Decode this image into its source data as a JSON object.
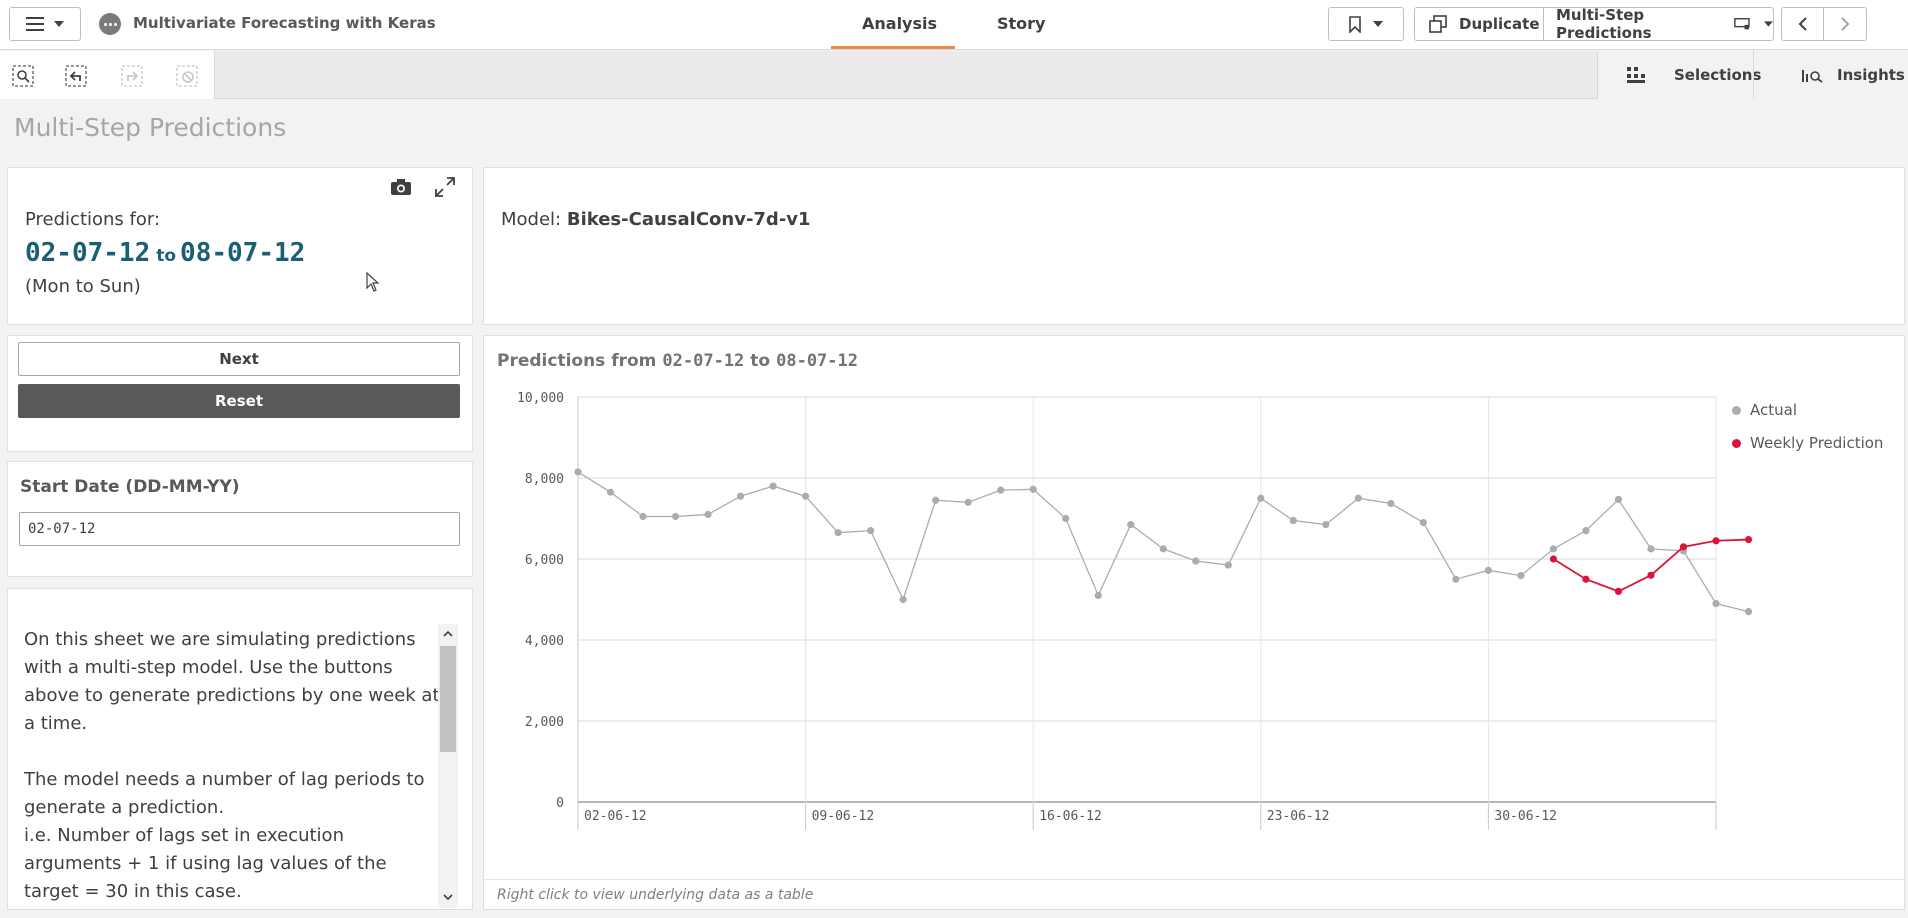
{
  "header": {
    "app_title": "Multivariate Forecasting with Keras",
    "tabs": [
      {
        "label": "Analysis"
      },
      {
        "label": "Story"
      }
    ],
    "duplicate_label": "Duplicate",
    "sheet_selector_label": "Multi-Step Predictions"
  },
  "toolbar": {
    "selections_label": "Selections",
    "insights_label": "Insights"
  },
  "sheet": {
    "title": "Multi-Step Predictions"
  },
  "prediction_panel": {
    "label": "Predictions for:",
    "start": "02-07-12",
    "connector": "to",
    "end": "08-07-12",
    "range_days": "(Mon to Sun)"
  },
  "model_panel": {
    "label": "Model:",
    "name": "Bikes-CausalConv-7d-v1"
  },
  "buttons": {
    "next_label": "Next",
    "reset_label": "Reset"
  },
  "start_date": {
    "label": "Start Date (DD-MM-YY)",
    "value": "02-07-12"
  },
  "description": {
    "para1": "On this sheet we are simulating predictions with a multi-step model. Use the buttons above to generate predictions by one week at a time.",
    "para2_line1": "The model needs a number of lag periods to generate a prediction.",
    "para2_line2": "i.e. Number of lags set in execution arguments + 1 if using lag values of the target = 30 in this case."
  },
  "chart_title": {
    "prefix": "Predictions from",
    "start": "02-07-12",
    "connector": "to",
    "end": "08-07-12"
  },
  "chart_footer": "Right click to view underlying data as a table",
  "colors": {
    "actual": "#a8adb4",
    "prediction": "#dc143c",
    "accent_date": "#1a5f74",
    "tab_underline": "#ed8a4a"
  },
  "chart_data": {
    "type": "line",
    "ylim": [
      0,
      10000
    ],
    "yticks": [
      "10,000",
      "8,000",
      "6,000",
      "4,000",
      "2,000",
      "0"
    ],
    "ytick_values": [
      10000,
      8000,
      6000,
      4000,
      2000,
      0
    ],
    "xtick_labels": [
      "02-06-12",
      "09-06-12",
      "16-06-12",
      "23-06-12",
      "30-06-12"
    ],
    "xtick_index": [
      0,
      7,
      14,
      21,
      28
    ],
    "x_count": 37,
    "legend": "right",
    "grid": true,
    "series": [
      {
        "name": "Actual",
        "start_index": 0,
        "values": [
          8150,
          7650,
          7050,
          7050,
          7100,
          7550,
          7800,
          7550,
          6650,
          6700,
          5000,
          7450,
          7400,
          7700,
          7720,
          7000,
          5100,
          6850,
          6250,
          5950,
          5850,
          7500,
          6950,
          6850,
          7500,
          7370,
          6900,
          5500,
          5720,
          5590,
          6250,
          6700,
          7470,
          6250,
          6200,
          4900,
          4700
        ]
      },
      {
        "name": "Weekly Prediction",
        "start_index": 30,
        "values": [
          6000,
          5500,
          5200,
          5600,
          6300,
          6450,
          6480
        ]
      }
    ]
  }
}
